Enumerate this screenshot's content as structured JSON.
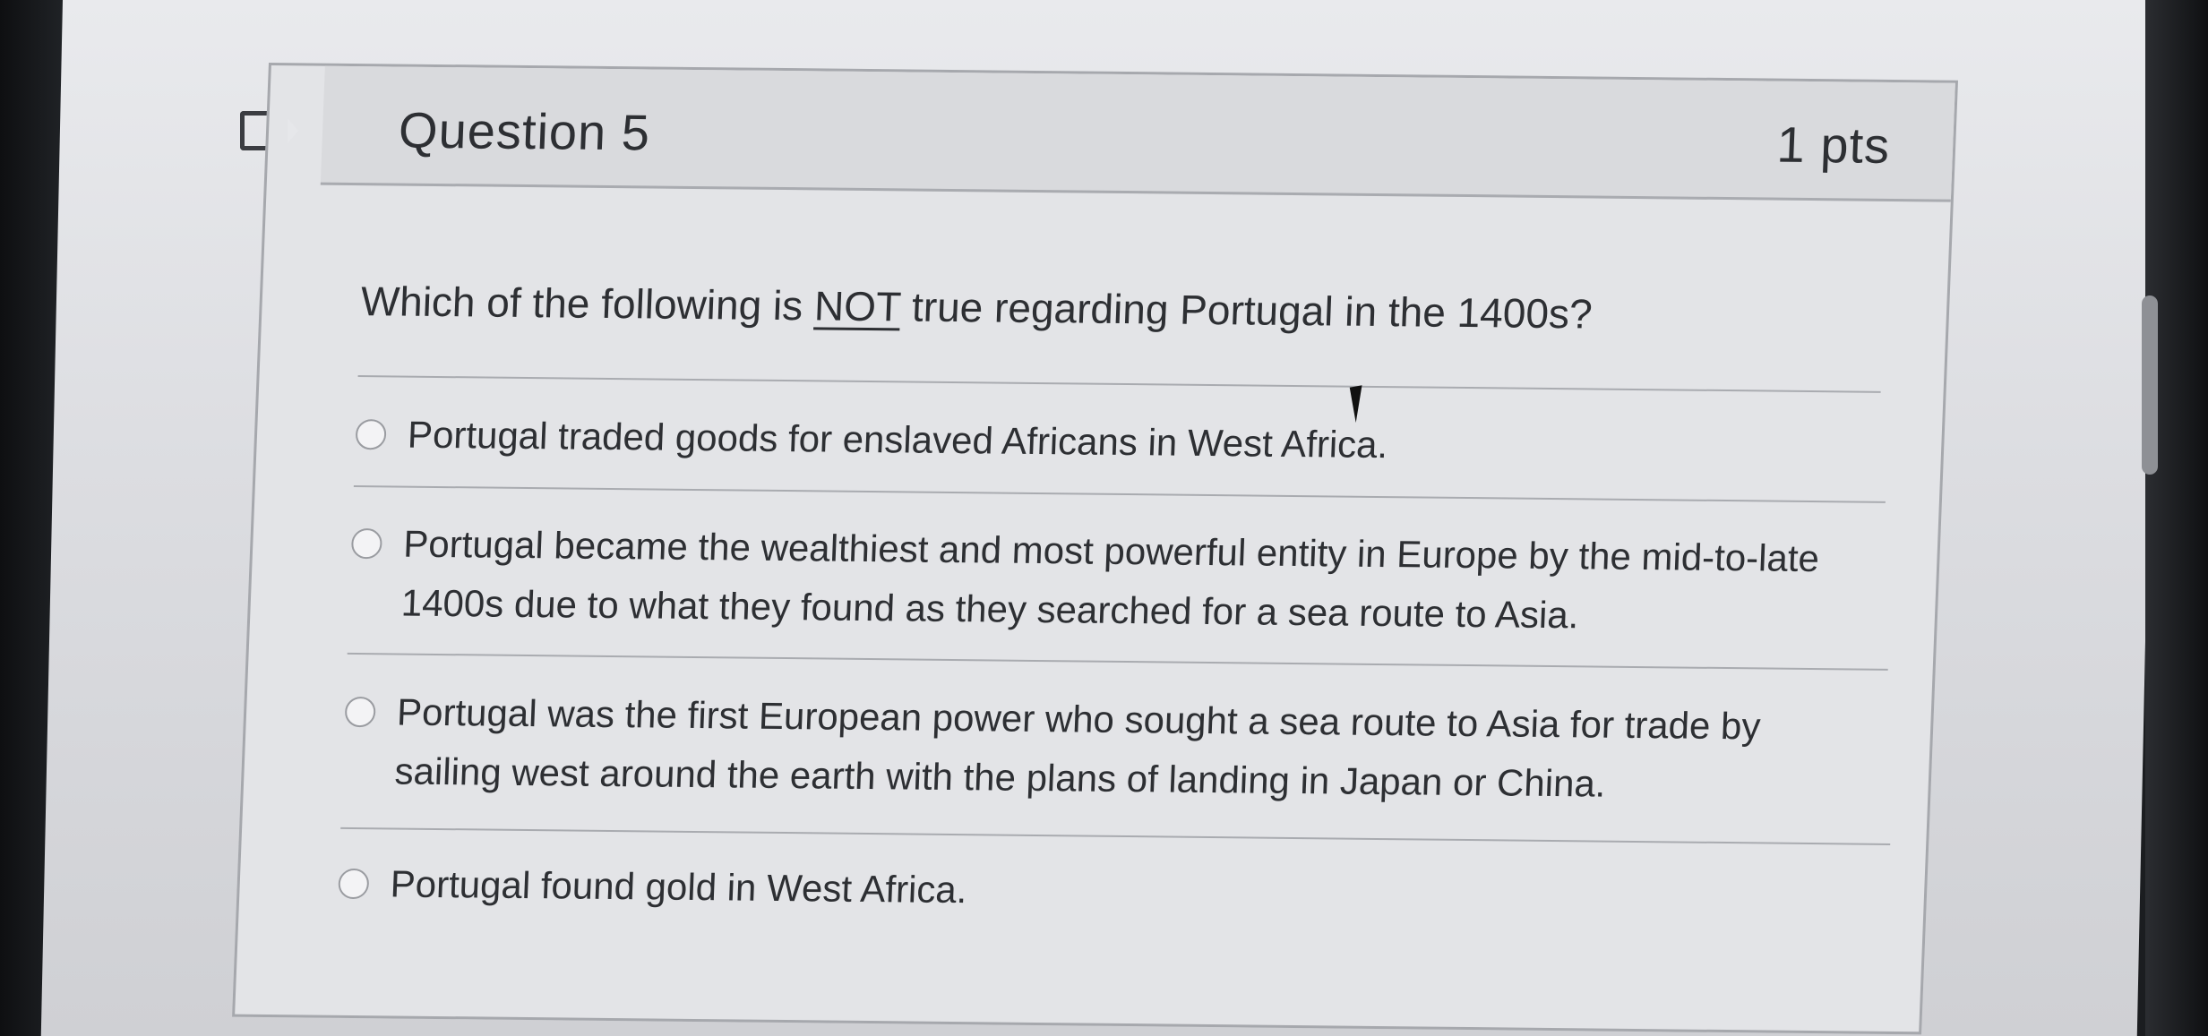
{
  "question": {
    "title": "Question 5",
    "points": "1 pts",
    "prompt_before": "Which of the following is ",
    "prompt_emphasis": "NOT",
    "prompt_after": " true regarding Portugal in the 1400s?"
  },
  "answers": [
    {
      "text": "Portugal traded goods for enslaved Africans in West Africa."
    },
    {
      "line1": "Portugal became the wealthiest and most powerful entity in Europe by the mid-to-late",
      "line2": "1400s due to what they found as they searched for a sea route to Asia."
    },
    {
      "line1": "Portugal was the first European power who sought a sea route to Asia for trade by",
      "line2": "sailing west around the earth with the plans of landing in Japan or China."
    },
    {
      "text": "Portugal found gold in West Africa."
    }
  ],
  "icons": {
    "flag": "flag-icon",
    "cursor": "mouse-cursor-icon"
  },
  "colors": {
    "text": "#2d2f33",
    "header_bg": "#d9dadd",
    "border": "#a9abb0"
  }
}
